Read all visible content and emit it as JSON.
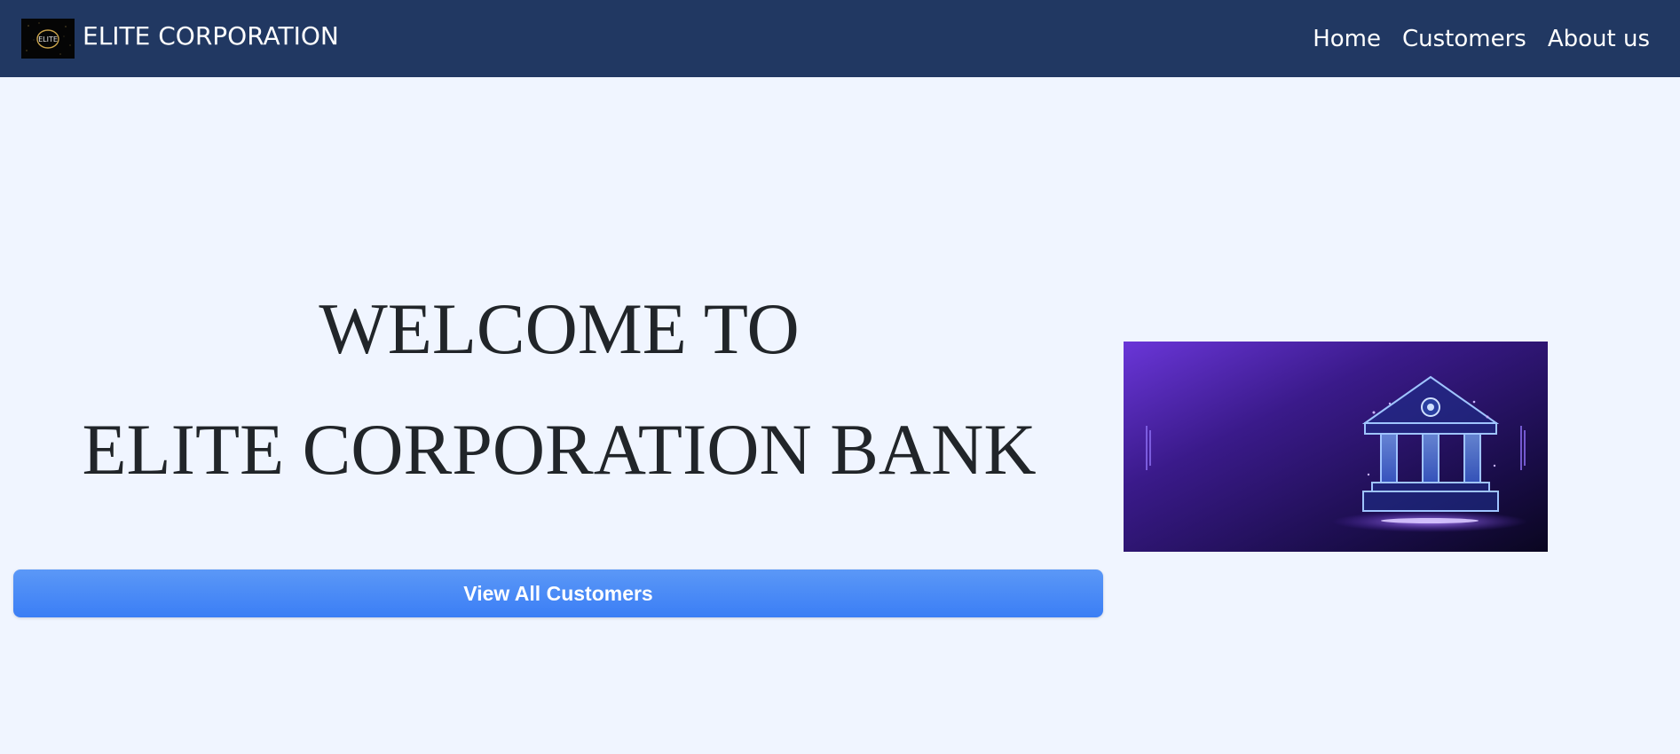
{
  "navbar": {
    "brand_name": "ELITE CORPORATION",
    "logo_text": "ELITE",
    "links": [
      {
        "label": "Home"
      },
      {
        "label": "Customers"
      },
      {
        "label": "About us"
      }
    ]
  },
  "hero": {
    "title_line1": "WELCOME TO",
    "title_line2": "ELITE CORPORATION BANK",
    "cta_label": "View All Customers",
    "image_icon": "bank-building-icon"
  },
  "colors": {
    "navbar_bg": "#213862",
    "page_bg": "#f0f5ff",
    "button_bg": "#3b7ef5",
    "text_dark": "#212529"
  }
}
